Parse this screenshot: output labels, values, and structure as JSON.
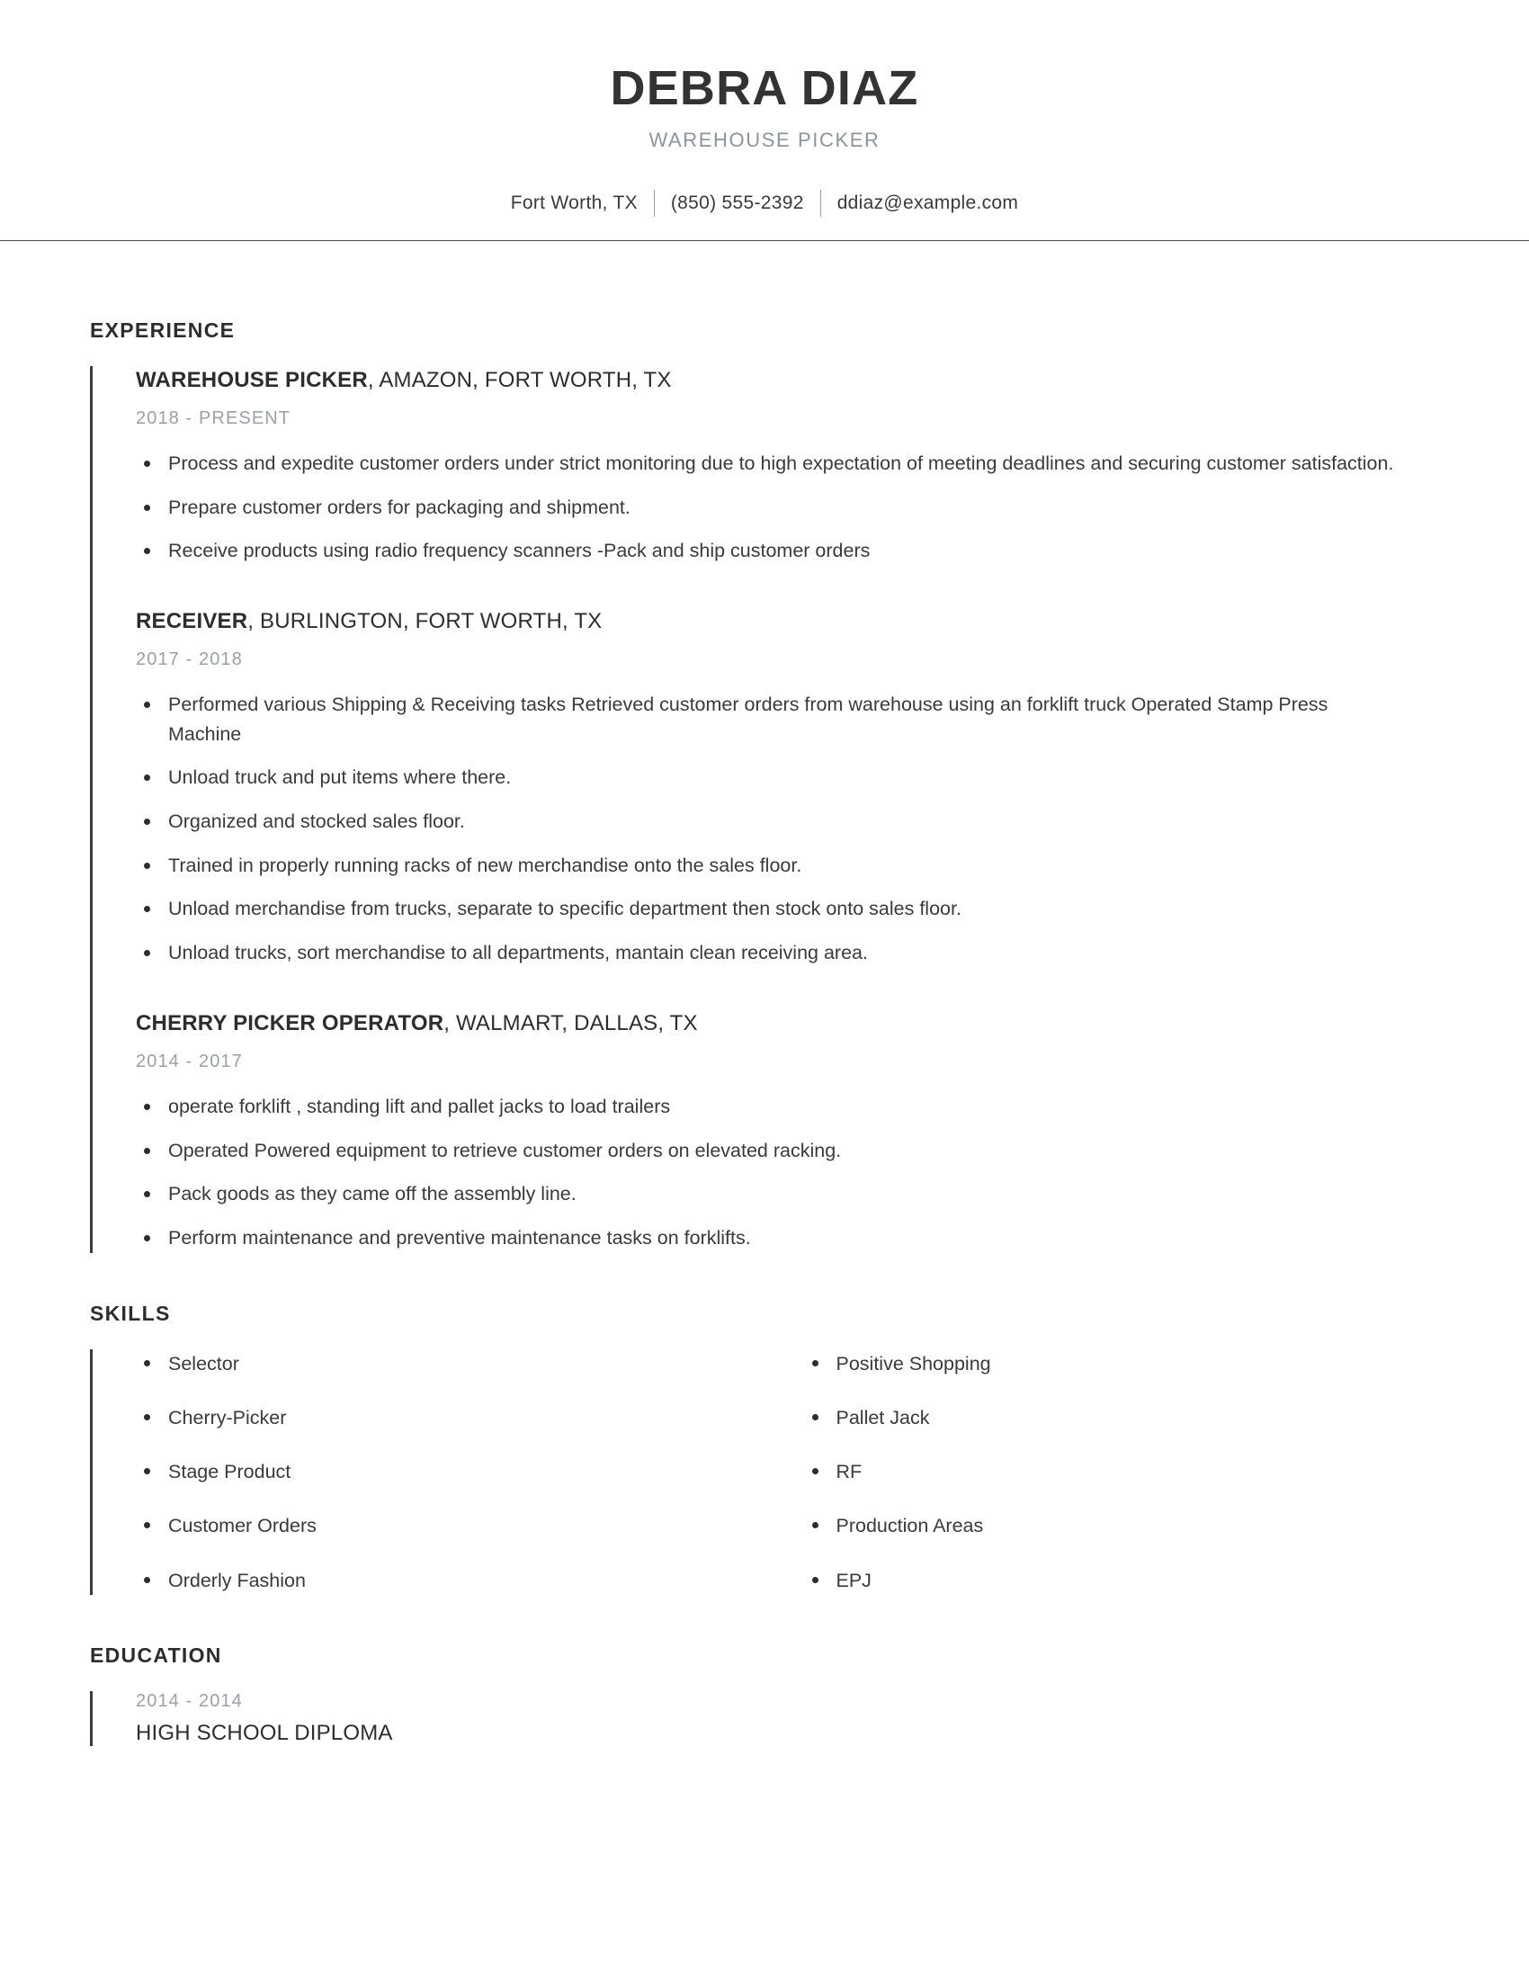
{
  "header": {
    "name": "DEBRA DIAZ",
    "job_subtitle": "WAREHOUSE PICKER",
    "contact": {
      "location": "Fort Worth, TX",
      "phone": "(850) 555-2392",
      "email": "ddiaz@example.com"
    }
  },
  "sections": {
    "experience": {
      "title": "EXPERIENCE",
      "jobs": [
        {
          "role": "WAREHOUSE PICKER",
          "rest": ", AMAZON, FORT WORTH, TX",
          "dates": "2018 - PRESENT",
          "bullets": [
            "Process and expedite customer orders under strict monitoring due to high expectation of meeting deadlines and securing customer satisfaction.",
            "Prepare customer orders for packaging and shipment.",
            "Receive products using radio frequency scanners -Pack and ship customer orders"
          ]
        },
        {
          "role": "RECEIVER",
          "rest": ", BURLINGTON, FORT WORTH, TX",
          "dates": "2017 - 2018",
          "bullets": [
            "Performed various Shipping & Receiving tasks Retrieved customer orders from warehouse using an forklift truck Operated Stamp Press Machine",
            "Unload truck and put items where there.",
            "Organized and stocked sales floor.",
            "Trained in properly running racks of new merchandise onto the sales floor.",
            "Unload merchandise from trucks, separate to specific department then stock onto sales floor.",
            "Unload trucks, sort merchandise to all departments, mantain clean receiving area."
          ]
        },
        {
          "role": "CHERRY PICKER OPERATOR",
          "rest": ", WALMART, DALLAS, TX",
          "dates": "2014 - 2017",
          "bullets": [
            "operate forklift , standing lift and pallet jacks to load trailers",
            "Operated Powered equipment to retrieve customer orders on elevated racking.",
            "Pack goods as they came off the assembly line.",
            "Perform maintenance and preventive maintenance tasks on forklifts."
          ]
        }
      ]
    },
    "skills": {
      "title": "SKILLS",
      "column_left": [
        "Selector",
        "Cherry-Picker",
        "Stage Product",
        "Customer Orders",
        "Orderly Fashion"
      ],
      "column_right": [
        "Positive Shopping",
        "Pallet Jack",
        "RF",
        "Production Areas",
        "EPJ"
      ]
    },
    "education": {
      "title": "EDUCATION",
      "entries": [
        {
          "dates": "2014 - 2014",
          "degree": "HIGH SCHOOL DIPLOMA"
        }
      ]
    }
  },
  "colors": {
    "text_primary": "#2d2d2d",
    "text_body": "#3a3a3a",
    "muted": "#9aa0a6",
    "rule": "#4a4a4a"
  }
}
